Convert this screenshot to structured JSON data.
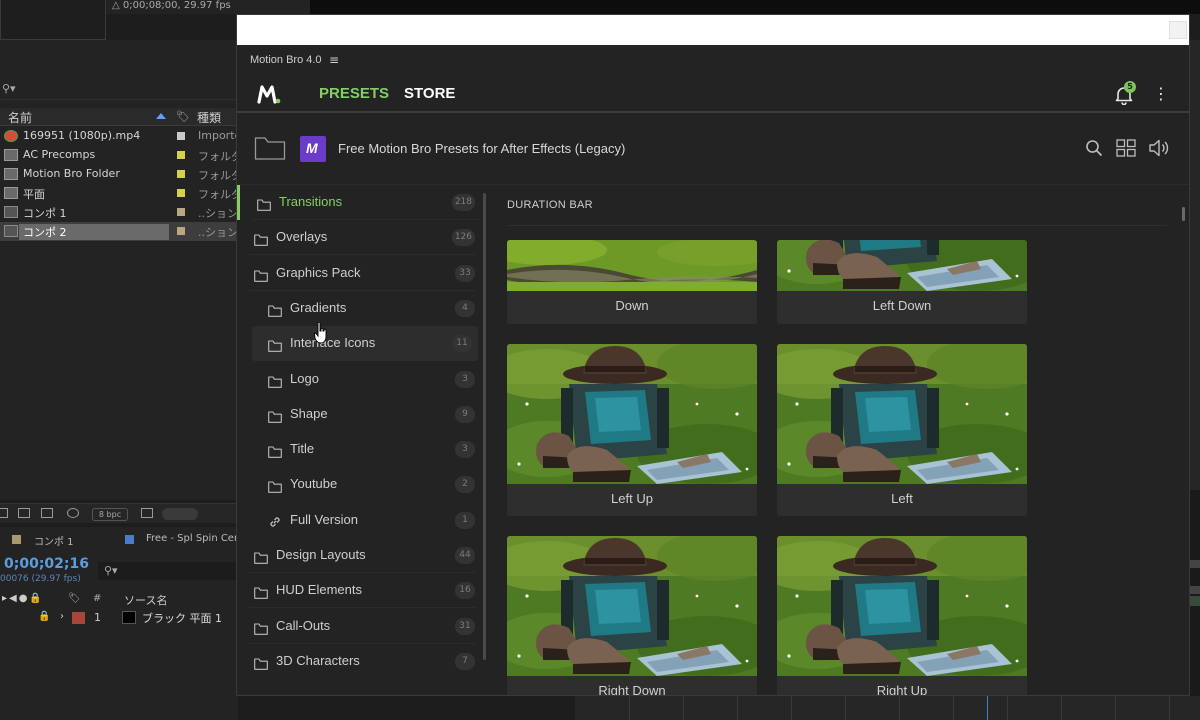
{
  "after_effects": {
    "info_text": "△ 0;00;08;00, 29.97 fps",
    "project": {
      "column_name": "名前",
      "column_type": "種類",
      "items": [
        {
          "name": "169951 (1080p).mp4",
          "type": "Importe",
          "label_color": "#c9c9c9",
          "icon": "chrome-icon"
        },
        {
          "name": "AC Precomps",
          "type": "フォルダ",
          "label_color": "#d6d04a",
          "icon": "folder-icon"
        },
        {
          "name": "Motion Bro Folder",
          "type": "フォルダ",
          "label_color": "#d6d04a",
          "icon": "folder-icon"
        },
        {
          "name": "平面",
          "type": "フォルダ",
          "label_color": "#d6d04a",
          "icon": "folder-icon"
        },
        {
          "name": "コンポ 1",
          "type": "..ション",
          "label_color": "#b8a880",
          "icon": "comp-icon"
        },
        {
          "name": "コンポ 2",
          "type": "..ション",
          "label_color": "#b8a880",
          "icon": "comp-icon"
        }
      ],
      "bpc": "8 bpc"
    },
    "timeline": {
      "tab1": "コンポ 1",
      "tab2": "Free - Spl Spin Cent",
      "timecode": "0;00;02;16",
      "frames": "00076 (29.97 fps)",
      "col_hash": "#",
      "col_source": "ソース名",
      "layer_number": "1",
      "layer_name": "ブラック 平面 1"
    }
  },
  "motion_bro": {
    "title": "Motion Bro 4.0",
    "menu_icon": "≡",
    "tabs": {
      "presets": "PRESETS",
      "store": "STORE"
    },
    "notification_count": "5",
    "pack_title": "Free Motion Bro Presets for After Effects (Legacy)",
    "pack_icon_letter": "M",
    "section_title": "DURATION BAR",
    "accent_color": "#86cd68",
    "categories": [
      {
        "name": "Transitions",
        "count": "218",
        "level": "top",
        "icon": "folder-icon",
        "active": true
      },
      {
        "name": "Overlays",
        "count": "126",
        "level": "top",
        "icon": "folder-icon"
      },
      {
        "name": "Graphics Pack",
        "count": "33",
        "level": "top",
        "icon": "folder-icon"
      },
      {
        "name": "Gradients",
        "count": "4",
        "level": "sub",
        "icon": "folder-icon"
      },
      {
        "name": "Interface Icons",
        "count": "11",
        "level": "sub",
        "icon": "folder-icon",
        "hover": true
      },
      {
        "name": "Logo",
        "count": "3",
        "level": "sub",
        "icon": "folder-icon"
      },
      {
        "name": "Shape",
        "count": "9",
        "level": "sub",
        "icon": "folder-icon"
      },
      {
        "name": "Title",
        "count": "3",
        "level": "sub",
        "icon": "folder-icon"
      },
      {
        "name": "Youtube",
        "count": "2",
        "level": "sub",
        "icon": "folder-icon"
      },
      {
        "name": "Full Version",
        "count": "1",
        "level": "sub",
        "icon": "link-icon"
      },
      {
        "name": "Design Layouts",
        "count": "44",
        "level": "top",
        "icon": "folder-icon"
      },
      {
        "name": "HUD Elements",
        "count": "16",
        "level": "top",
        "icon": "folder-icon"
      },
      {
        "name": "Call-Outs",
        "count": "31",
        "level": "top",
        "icon": "folder-icon"
      },
      {
        "name": "3D Characters",
        "count": "7",
        "level": "top",
        "icon": "folder-icon"
      }
    ],
    "presets": [
      {
        "name": "Down",
        "thumb": "grass-stream"
      },
      {
        "name": "Left Down",
        "thumb": "backpack"
      },
      {
        "name": "Left Up",
        "thumb": "backpack"
      },
      {
        "name": "Left",
        "thumb": "backpack"
      },
      {
        "name": "Right Down",
        "thumb": "backpack"
      },
      {
        "name": "Right Up",
        "thumb": "backpack"
      }
    ]
  }
}
